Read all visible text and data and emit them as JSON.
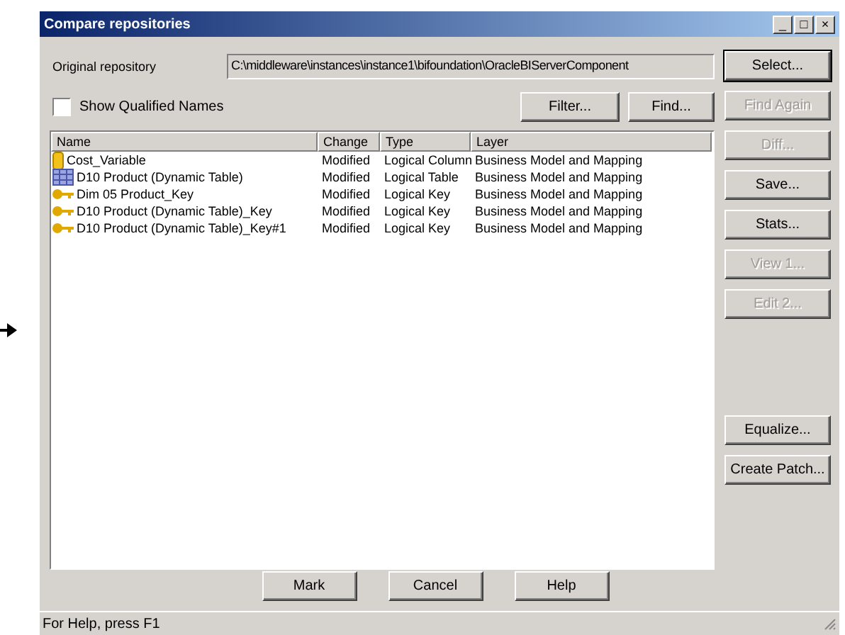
{
  "window": {
    "title": "Compare repositories",
    "controls": [
      "_",
      "□",
      "×"
    ]
  },
  "original_repository": {
    "label": "Original repository",
    "value": "C:\\middleware\\instances\\instance1\\bifoundation\\OracleBIServerComponent"
  },
  "show_qualified_names": {
    "label": "Show Qualified Names",
    "checked": false
  },
  "top_buttons": [
    {
      "label": "Filter...",
      "disabled": false
    },
    {
      "label": "Find...",
      "disabled": false
    }
  ],
  "table": {
    "columns": [
      "Name",
      "Change",
      "Type",
      "Layer"
    ],
    "rows": [
      {
        "kind": "column",
        "cells": [
          "Cost_Variable",
          "Modified",
          "Logical Column",
          "Business Model and Mapping"
        ]
      },
      {
        "kind": "table",
        "cells": [
          "D10 Product (Dynamic Table)",
          "Modified",
          "Logical Table",
          "Business Model and Mapping"
        ]
      },
      {
        "kind": "key",
        "cells": [
          "Dim 05 Product_Key",
          "Modified",
          "Logical Key",
          "Business Model and Mapping"
        ]
      },
      {
        "kind": "key",
        "cells": [
          "D10 Product (Dynamic Table)_Key",
          "Modified",
          "Logical Key",
          "Business Model and Mapping"
        ]
      },
      {
        "kind": "key",
        "cells": [
          "D10 Product (Dynamic Table)_Key#1",
          "Modified",
          "Logical Key",
          "Business Model and Mapping"
        ]
      }
    ]
  },
  "side_buttons": [
    {
      "label": "Select...",
      "disabled": false,
      "default": true
    },
    {
      "label": "Find Again",
      "disabled": true
    },
    {
      "label": "Diff...",
      "disabled": true
    },
    {
      "label": "Save...",
      "disabled": false
    },
    {
      "label": "Stats...",
      "disabled": false
    },
    {
      "label": "View 1...",
      "disabled": true
    },
    {
      "label": "Edit 2...",
      "disabled": true
    },
    {
      "label": "Equalize...",
      "disabled": false
    },
    {
      "label": "Create Patch...",
      "disabled": false
    }
  ],
  "bottom_buttons": [
    {
      "label": "Mark"
    },
    {
      "label": "Cancel"
    },
    {
      "label": "Help"
    }
  ],
  "status_bar": "For Help, press F1"
}
